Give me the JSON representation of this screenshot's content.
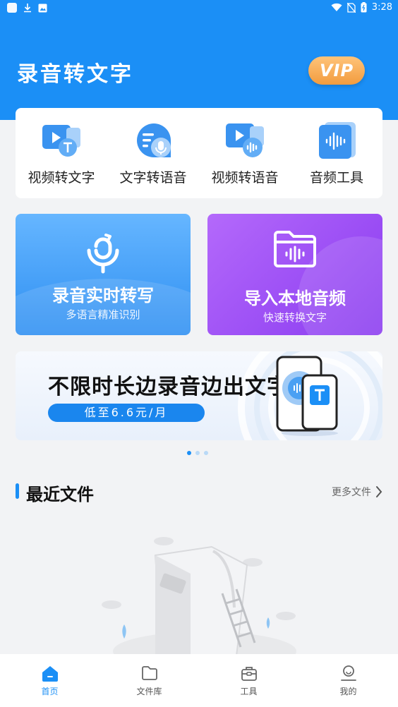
{
  "status_bar": {
    "time": "3:28"
  },
  "header": {
    "app_title": "录音转文字",
    "vip_label": "VIP"
  },
  "features": [
    {
      "label": "视频转文字",
      "icon": "video-to-text-icon"
    },
    {
      "label": "文字转语音",
      "icon": "text-to-speech-icon"
    },
    {
      "label": "视频转语音",
      "icon": "video-to-audio-icon"
    },
    {
      "label": "音频工具",
      "icon": "audio-tools-icon"
    }
  ],
  "cards": {
    "record": {
      "title": "录音实时转写",
      "subtitle": "多语言精准识别"
    },
    "import": {
      "title": "导入本地音频",
      "subtitle": "快速转换文字"
    }
  },
  "banner": {
    "title": "不限时长边录音边出文字",
    "price": "低至6.6元/月",
    "page_count": 3,
    "active_page": 0
  },
  "recent": {
    "title": "最近文件",
    "more_label": "更多文件"
  },
  "bottom_nav": [
    {
      "label": "首页",
      "icon": "home-icon",
      "active": true
    },
    {
      "label": "文件库",
      "icon": "folder-icon",
      "active": false
    },
    {
      "label": "工具",
      "icon": "toolbox-icon",
      "active": false
    },
    {
      "label": "我的",
      "icon": "profile-icon",
      "active": false
    }
  ],
  "colors": {
    "primary": "#1b8ff6",
    "vip": "#f29c3e",
    "import_card": "#8a3bf0"
  }
}
